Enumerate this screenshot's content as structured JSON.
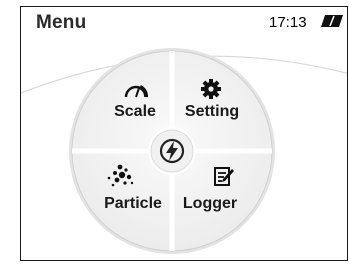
{
  "header": {
    "title": "Menu",
    "time": "17:13",
    "battery_icon": "battery-icon"
  },
  "menu": {
    "items": [
      {
        "label": "Scale",
        "icon": "gauge-icon"
      },
      {
        "label": "Setting",
        "icon": "gear-icon"
      },
      {
        "label": "Particle",
        "icon": "particles-icon"
      },
      {
        "label": "Logger",
        "icon": "logger-icon"
      }
    ],
    "center_icon": "power-bolt-icon"
  },
  "colors": {
    "wheel_fill": "#f4f4f4",
    "wheel_border": "#d8d8d8",
    "text": "#1a1a1a"
  }
}
